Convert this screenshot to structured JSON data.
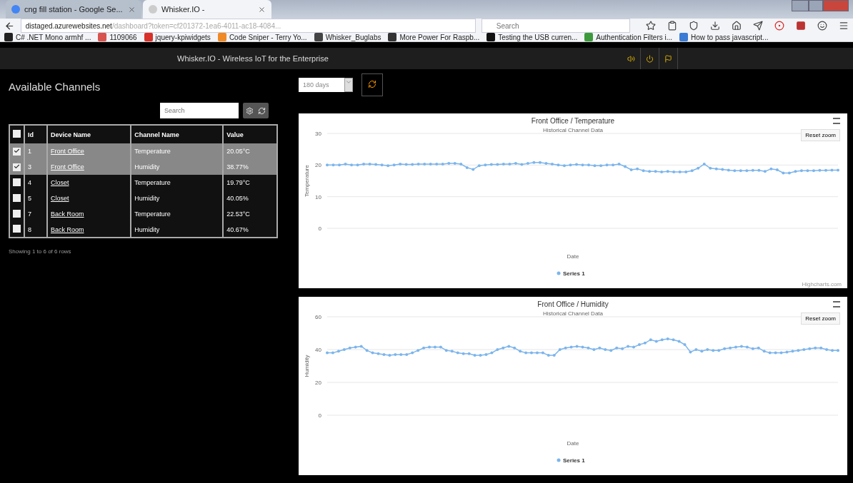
{
  "browser": {
    "tabs": [
      {
        "label": "cng fill station - Google Se...",
        "selected": false
      },
      {
        "label": "Whisker.IO -",
        "selected": true
      }
    ],
    "address": {
      "host": "distaged.azurewebsites.net",
      "path": "/dashboard?token=cf201372-1ea6-4011-ac18-4084..."
    },
    "search": {
      "placeholder": "Search"
    },
    "bookmarks": [
      {
        "label": "C# .NET Mono armhf ...",
        "color": "#222222"
      },
      {
        "label": "1109066",
        "color": "#d9534f"
      },
      {
        "label": "jquery-kpiwidgets",
        "color": "#d9302a"
      },
      {
        "label": "Code Sniper - Terry Yo...",
        "color": "#f08a24"
      },
      {
        "label": "Whisker_Buglabs",
        "color": "#444444"
      },
      {
        "label": "More Power For Raspb...",
        "color": "#333333"
      },
      {
        "label": "Testing the USB curren...",
        "color": "#111111"
      },
      {
        "label": "Authentication Filters i...",
        "color": "#3c9a3c"
      },
      {
        "label": "How to pass javascript...",
        "color": "#3a7bd5"
      }
    ]
  },
  "app": {
    "title": "Whisker.IO - Wireless IoT for the Enterprise"
  },
  "channels": {
    "title": "Available Channels",
    "search": {
      "placeholder": "Search"
    },
    "all_checked": false,
    "columns": [
      "Id",
      "Device Name",
      "Channel Name",
      "Value"
    ],
    "rows": [
      {
        "checked": true,
        "id": "1",
        "device": "Front Office",
        "channel": "Temperature",
        "value": "20.05°C"
      },
      {
        "checked": true,
        "id": "3",
        "device": "Front Office",
        "channel": "Humidity",
        "value": "38.77%"
      },
      {
        "checked": false,
        "id": "4",
        "device": "Closet",
        "channel": "Temperature",
        "value": "19.79°C"
      },
      {
        "checked": false,
        "id": "5",
        "device": "Closet",
        "channel": "Humidity",
        "value": "40.05%"
      },
      {
        "checked": false,
        "id": "7",
        "device": "Back Room",
        "channel": "Temperature",
        "value": "22.53°C"
      },
      {
        "checked": false,
        "id": "8",
        "device": "Back Room",
        "channel": "Humidity",
        "value": "40.67%"
      }
    ],
    "footer": "Showing 1 to 6 of 6 rows"
  },
  "range": {
    "value": "180 days"
  },
  "charts": [
    {
      "subtitle": "Historical Channel Data",
      "reset": "Reset zoom",
      "credits": "Highcharts.com",
      "chart_data": {
        "type": "line",
        "title": "Front Office / Temperature",
        "xlabel": "Date",
        "ylabel": "Temperature",
        "ylim": [
          0,
          30
        ],
        "yticks": [
          0,
          10,
          20,
          30
        ],
        "series": [
          {
            "name": "Series 1",
            "color": "#7cb5ec",
            "values": [
              20,
              20,
              20,
              20.3,
              20,
              20,
              20.3,
              20.3,
              20.2,
              20,
              19.8,
              20,
              20.3,
              20.2,
              20.2,
              20.3,
              20.3,
              20.3,
              20.3,
              20.3,
              20.5,
              20.5,
              20.3,
              19.2,
              18.6,
              19.8,
              20,
              20.2,
              20.2,
              20.3,
              20.3,
              20.5,
              20.2,
              20.5,
              20.8,
              20.8,
              20.5,
              20.3,
              20,
              19.8,
              20,
              20.2,
              20,
              20,
              19.8,
              19.8,
              20,
              20,
              20.3,
              19.5,
              18.5,
              18.8,
              18.2,
              18,
              18,
              17.8,
              18,
              17.8,
              17.8,
              17.8,
              18.2,
              19,
              20.3,
              19,
              18.8,
              18.6,
              18.4,
              18.2,
              18.2,
              18.2,
              18.3,
              18.3,
              18,
              18.8,
              18.5,
              17.5,
              17.5,
              18,
              18.2,
              18.2,
              18.2,
              18.3,
              18.3,
              18.4,
              18.4
            ]
          }
        ]
      }
    },
    {
      "subtitle": "Historical Channel Data",
      "reset": "Reset zoom",
      "chart_data": {
        "type": "line",
        "title": "Front Office / Humidity",
        "xlabel": "Date",
        "ylabel": "Humidity",
        "ylim": [
          0,
          60
        ],
        "yticks": [
          0,
          20,
          40,
          60
        ],
        "series": [
          {
            "name": "Series 1",
            "color": "#7cb5ec",
            "values": [
              38,
              38,
              39,
              40,
              41,
              41.5,
              42,
              39.5,
              38,
              37.5,
              37,
              36.5,
              37,
              37,
              37,
              38,
              39.5,
              41,
              41.5,
              41.5,
              41.5,
              39.5,
              39,
              38,
              37.5,
              37.5,
              36.5,
              36.5,
              37,
              38,
              40,
              41,
              42,
              41,
              39,
              38,
              38,
              38,
              38,
              36.5,
              36.5,
              40,
              41,
              41.5,
              42,
              41.5,
              41,
              40,
              41,
              40,
              39.5,
              41,
              40.5,
              42,
              41.5,
              43,
              44,
              46,
              45,
              46,
              46.5,
              46,
              45,
              43,
              38.5,
              40,
              39,
              40,
              39.5,
              39.5,
              40.5,
              41,
              41.5,
              42,
              41.5,
              40.5,
              41,
              39,
              38,
              38,
              38,
              38.5,
              39,
              39.5,
              40,
              40.5,
              41,
              41,
              40,
              39.5,
              39.5
            ]
          }
        ]
      }
    }
  ]
}
